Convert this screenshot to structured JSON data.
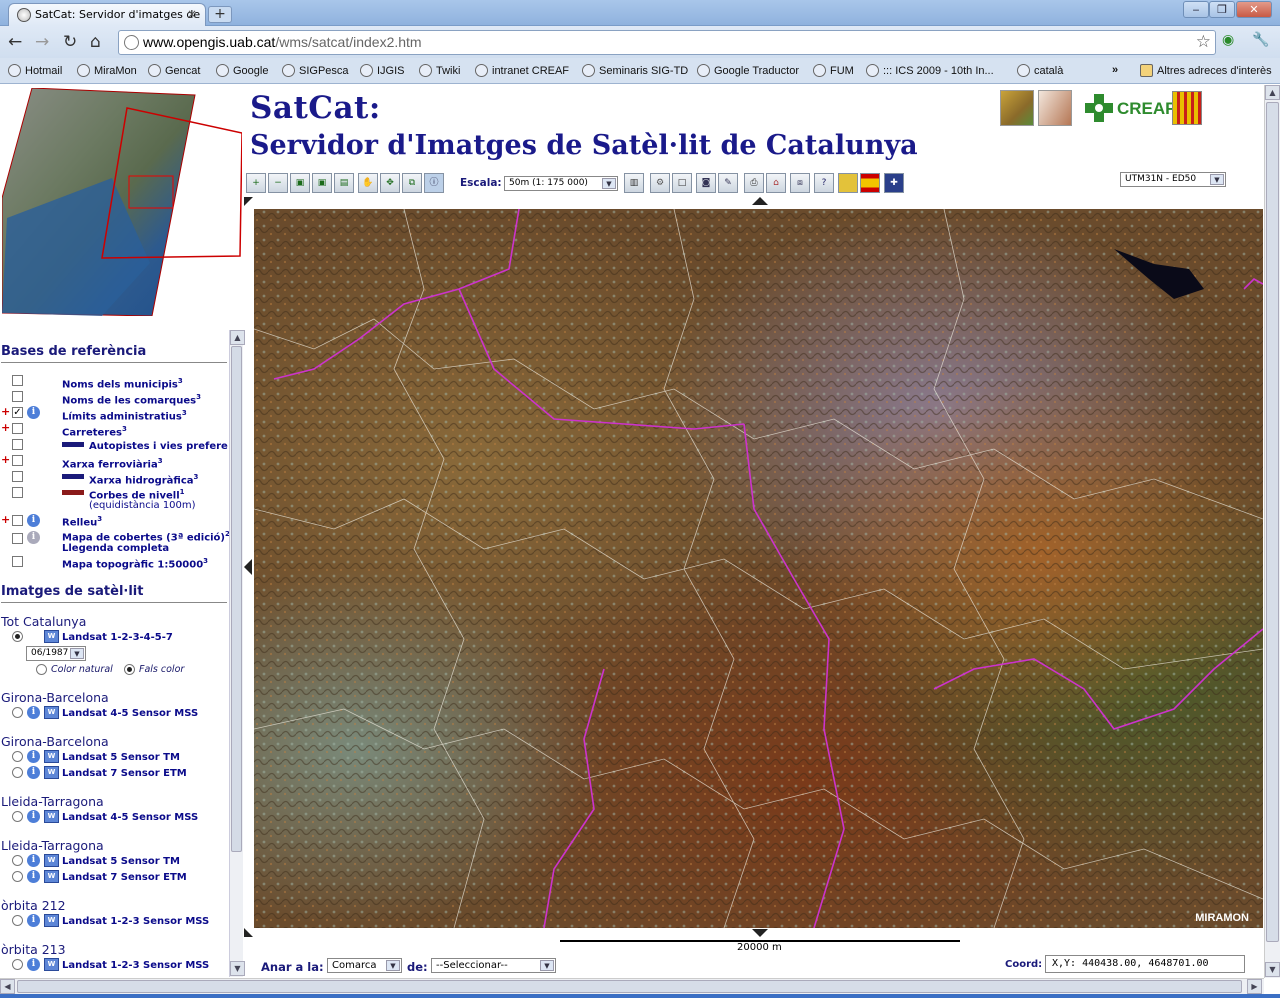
{
  "browser": {
    "tab_title": "SatCat: Servidor d'imatges de",
    "tab_close": "×",
    "new_tab": "+",
    "url_host": "www.opengis.uab.cat",
    "url_path": "/wms/satcat/index2.htm",
    "bookmarks": [
      "Hotmail",
      "MiraMon",
      "Gencat",
      "Google",
      "SIGPesca",
      "IJGIS",
      "Twiki",
      "intranet CREAF",
      "Seminaris SIG-TD",
      "Google Traductor",
      "FUM",
      "::: ICS 2009 - 10th In...",
      "català"
    ],
    "bookmarks_more": "»",
    "other_bookmarks": "Altres adreces d'interès"
  },
  "header": {
    "title_line1": "SatCat:",
    "title_line2": "Servidor d'Imatges de Satèl·lit de Catalunya",
    "creaf": "CREAF"
  },
  "toolbar": {
    "escala_label": "Escala:",
    "escala_value": "50m (1: 175 000)",
    "projection": "UTM31N - ED50"
  },
  "left": {
    "bases_title": "Bases de referència",
    "layers": [
      {
        "label": "Noms dels municipis",
        "sup": "3"
      },
      {
        "label": "Noms de les comarques",
        "sup": "3"
      },
      {
        "label": "Límits administratius",
        "sup": "3"
      },
      {
        "label": "Carreteres",
        "sup": "3"
      },
      {
        "label": "Autopistes i vies prefere",
        "sup": ""
      },
      {
        "label": "Xarxa ferroviària",
        "sup": "3"
      },
      {
        "label": "Xarxa hidrogràfica",
        "sup": "3"
      },
      {
        "label": "Corbes de nivell",
        "sup": "1"
      },
      {
        "label": "(equidistància 100m)",
        "sup": ""
      },
      {
        "label": "Relleu",
        "sup": "3"
      },
      {
        "label": "Mapa de cobertes (3ª edició)",
        "sup": "2"
      },
      {
        "label": "Llegenda completa",
        "sup": ""
      },
      {
        "label": "Mapa topogràfic 1:50000",
        "sup": "3"
      }
    ],
    "imatges_title": "Imatges de satèl·lit",
    "groups": [
      {
        "name": "Tot Catalunya",
        "items": [
          "Landsat 1-2-3-4-5-7"
        ]
      },
      {
        "name": "Girona-Barcelona",
        "items": [
          "Landsat 4-5 Sensor MSS"
        ]
      },
      {
        "name": "Girona-Barcelona",
        "items": [
          "Landsat 5 Sensor TM",
          "Landsat 7 Sensor ETM"
        ]
      },
      {
        "name": "Lleida-Tarragona",
        "items": [
          "Landsat 4-5 Sensor MSS"
        ]
      },
      {
        "name": "Lleida-Tarragona",
        "items": [
          "Landsat 5 Sensor TM",
          "Landsat 7 Sensor ETM"
        ]
      },
      {
        "name": "òrbita 212",
        "items": [
          "Landsat 1-2-3 Sensor MSS"
        ]
      },
      {
        "name": "òrbita 213",
        "items": [
          "Landsat 1-2-3 Sensor MSS"
        ]
      }
    ],
    "date_value": "06/1987",
    "color_natural": "Color natural",
    "fals_color": "Fals color"
  },
  "map": {
    "scale_text": "20000 m",
    "brand": "MIRAMON",
    "anar_label": "Anar a la:",
    "anar_value": "Comarca",
    "de_label": "de:",
    "de_value": "--Seleccionar--",
    "coord_label": "Coord:",
    "coord_value": "X,Y: 440438.00, 4648701.00"
  },
  "colors": {
    "title": "#1a1a8a",
    "boundary": "#cc33cc",
    "creaf": "#2e8b2e"
  }
}
